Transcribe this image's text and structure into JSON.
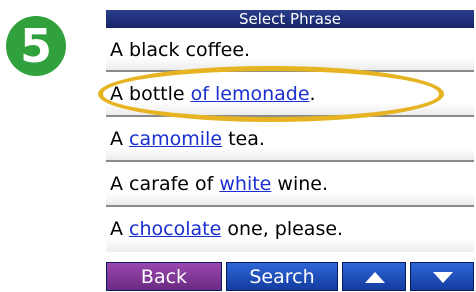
{
  "step": {
    "number": "5",
    "color": "#31a13d"
  },
  "title": "Select Phrase",
  "phrases": [
    {
      "before": "A black coffee.",
      "link": "",
      "after": ""
    },
    {
      "before": "A bottle ",
      "link": "of lemonade",
      "after": "."
    },
    {
      "before": "A ",
      "link": "camomile",
      "after": " tea."
    },
    {
      "before": "A carafe of ",
      "link": "white",
      "after": " wine."
    },
    {
      "before": "A ",
      "link": "chocolate",
      "after": " one, please."
    }
  ],
  "buttons": {
    "back_label": "Back",
    "search_label": "Search",
    "up_icon": "arrow-up-icon",
    "down_icon": "arrow-down-icon"
  },
  "highlight_color": "#e6b422"
}
